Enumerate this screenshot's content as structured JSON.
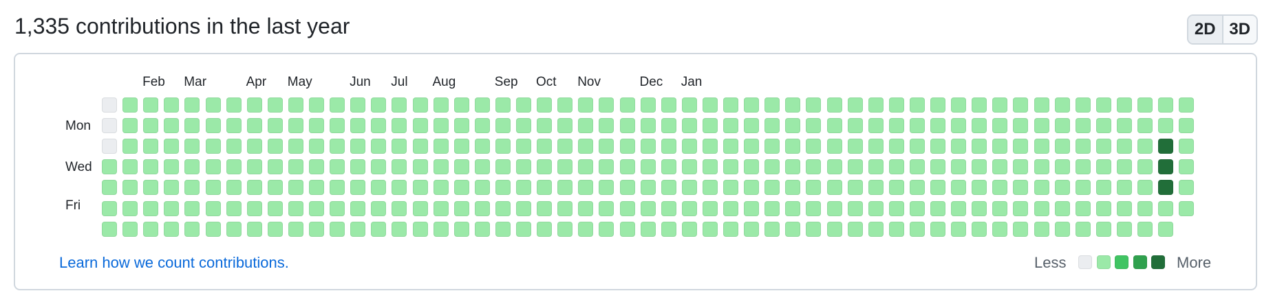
{
  "header": {
    "title": "1,335 contributions in the last year"
  },
  "view_toggle": {
    "options": [
      "2D",
      "3D"
    ],
    "selected": "2D"
  },
  "calendar": {
    "months": [
      "Feb",
      "Mar",
      "Apr",
      "May",
      "Jun",
      "Jul",
      "Aug",
      "Sep",
      "Oct",
      "Nov",
      "Dec",
      "Jan"
    ],
    "day_labels": [
      "Mon",
      "Wed",
      "Fri"
    ],
    "weeks": 53,
    "days_per_week": 7,
    "empty_cells": [
      [
        0,
        0
      ],
      [
        0,
        1
      ],
      [
        0,
        2
      ]
    ],
    "darkest_cells": [
      [
        51,
        2
      ],
      [
        51,
        3
      ],
      [
        51,
        4
      ]
    ],
    "missing_cells": [
      [
        52,
        6
      ]
    ],
    "default_level": 1
  },
  "footer": {
    "learn_link": "Learn how we count contributions.",
    "legend_less": "Less",
    "legend_more": "More"
  },
  "colors": {
    "level_0": "#ebedf0",
    "level_1": "#9be9a8",
    "level_2": "#40c463",
    "level_3": "#30a14e",
    "level_4": "#216e39",
    "link": "#0969da"
  }
}
